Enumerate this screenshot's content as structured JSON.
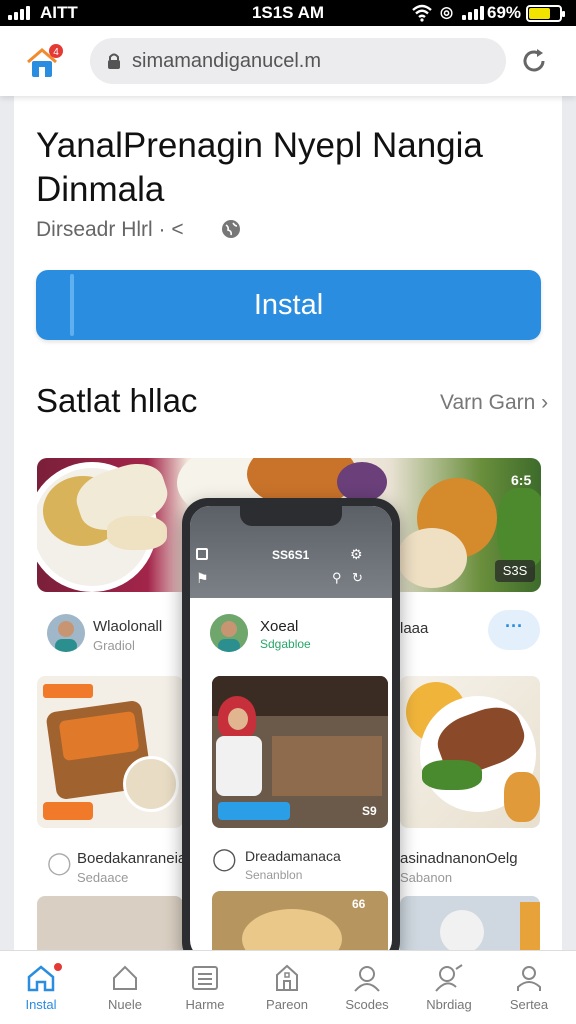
{
  "status_bar": {
    "carrier": "AITT",
    "time": "1S1S AM",
    "battery_percent": "69%",
    "battery_level": 0.7
  },
  "browser": {
    "url": "simamandiganucel.m",
    "home_badge": "4"
  },
  "app": {
    "title": "YanalPrenagin Nyepl Nangia Dinmala",
    "developer": "Dirseadr Hlrl ·",
    "install_label": "Instal"
  },
  "section": {
    "title": "Satlat hllac",
    "view_all": "Varn Garn"
  },
  "banner": {
    "badge_corner": "S3S",
    "badge_top": "6:5"
  },
  "left_card": {
    "name": "Wlaolonall",
    "sub": "Gradiol",
    "tag": "",
    "bottom_name": "Boedakanraneia",
    "bottom_sub": "Sedaace"
  },
  "phone": {
    "status_text": "SS6S1",
    "user_name": "Xoeal",
    "user_sub": "Sdgabloe",
    "photo_badge": "S9",
    "post_name": "Dreadamanaca",
    "post_sub": "Senanblon",
    "bottom_badge": "66"
  },
  "right_card": {
    "name": "laaa",
    "bottom_name": "asinadnanonOelg",
    "bottom_sub": "Sabanon"
  },
  "bottom_nav": [
    {
      "label": "Instal",
      "icon": "home-icon",
      "active": true
    },
    {
      "label": "Nuele",
      "icon": "tag-icon",
      "active": false
    },
    {
      "label": "Harme",
      "icon": "list-icon",
      "active": false
    },
    {
      "label": "Pareon",
      "icon": "building-icon",
      "active": false
    },
    {
      "label": "Scodes",
      "icon": "user-icon",
      "active": false
    },
    {
      "label": "Nbrdiag",
      "icon": "user-search-icon",
      "active": false
    },
    {
      "label": "Sertea",
      "icon": "person-icon",
      "active": false
    }
  ],
  "colors": {
    "accent": "#2a8de0",
    "battery": "#f2e400"
  }
}
